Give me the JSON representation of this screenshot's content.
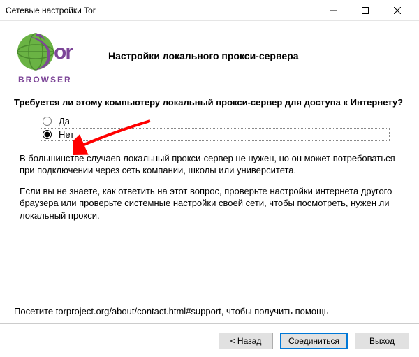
{
  "window": {
    "title": "Сетевые настройки Tor"
  },
  "logo": {
    "top_text": "Tor",
    "bottom_text": "BROWSER"
  },
  "heading": "Настройки локального прокси-сервера",
  "question": "Требуется ли этому компьютеру локальный прокси-сервер для доступа к Интернету?",
  "radios": {
    "yes": "Да",
    "no": "Нет",
    "selected": "no"
  },
  "para1": "В большинстве случаев локальный прокси-сервер не нужен, но он может потребоваться при подключении через сеть компании, школы или университета.",
  "para2": "Если вы не знаете, как ответить на этот вопрос, проверьте настройки интернета другого браузера или проверьте системные настройки своей сети, чтобы посмотреть, нужен ли локальный прокси.",
  "footer_note": "Посетите torproject.org/about/contact.html#support, чтобы получить помощь",
  "buttons": {
    "back": "< Назад",
    "connect": "Соединиться",
    "exit": "Выход"
  },
  "colors": {
    "accent": "#0078d7",
    "logo_purple": "#7d4698",
    "logo_green": "#6ab344",
    "arrow": "#ff0000"
  }
}
